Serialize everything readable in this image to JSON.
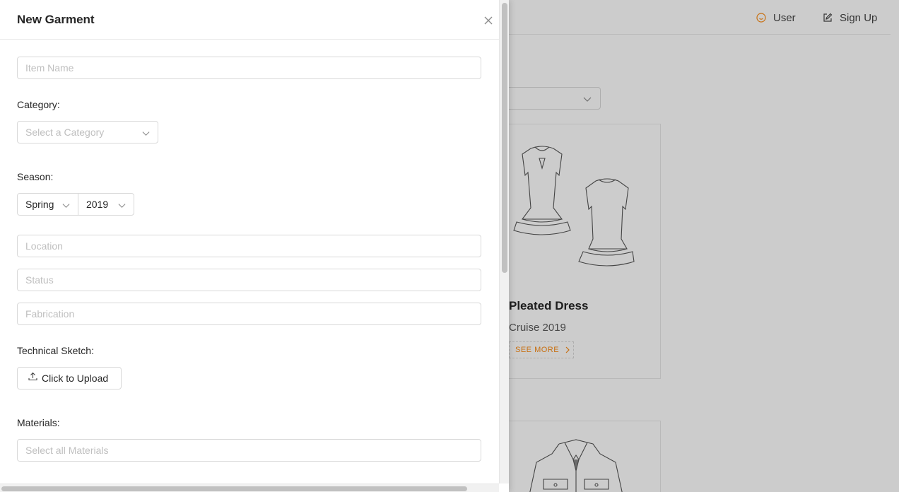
{
  "header": {
    "nav": [
      {
        "label": "User",
        "icon": "smile-icon"
      },
      {
        "label": "Sign Up",
        "icon": "edit-icon"
      }
    ]
  },
  "background": {
    "cards": [
      {
        "title": "Pleated Dress",
        "subtitle": "Cruise 2019",
        "action": "SEE MORE",
        "image": "dress-sketch"
      },
      {
        "image": "jacket-sketch"
      }
    ]
  },
  "drawer": {
    "title": "New Garment",
    "fields": {
      "item_name": {
        "placeholder": "Item Name"
      },
      "category": {
        "label": "Category",
        "placeholder": "Select a Category"
      },
      "season": {
        "label": "Season",
        "season_value": "Spring",
        "year_value": "2019"
      },
      "location": {
        "placeholder": "Location"
      },
      "status": {
        "placeholder": "Status"
      },
      "fabrication": {
        "placeholder": "Fabrication"
      },
      "technical_sketch": {
        "label": "Technical Sketch",
        "button": "Click to Upload"
      },
      "materials": {
        "label": "Materials",
        "placeholder": "Select all Materials"
      }
    }
  },
  "colors": {
    "accent": "#fa8c16",
    "border": "#d9d9d9",
    "placeholder": "#bfbfbf",
    "mask": "rgba(0,0,0,0.2)"
  }
}
